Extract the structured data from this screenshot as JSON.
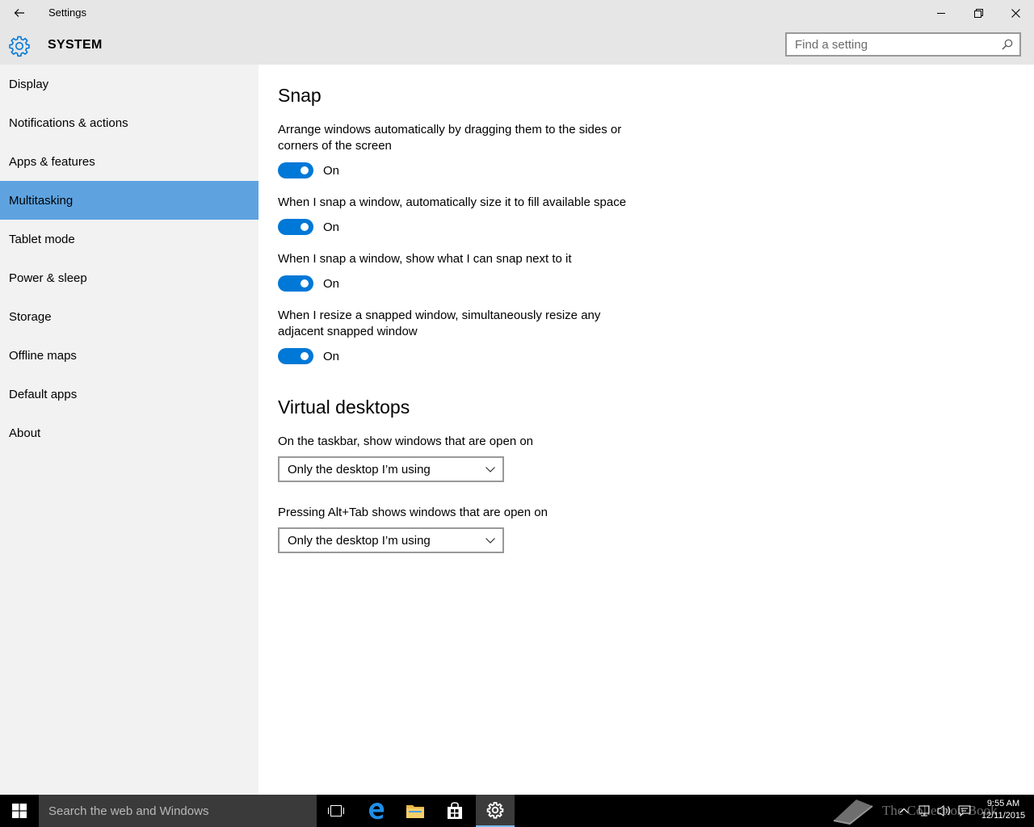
{
  "window": {
    "title": "Settings"
  },
  "header": {
    "section": "SYSTEM",
    "search_placeholder": "Find a setting"
  },
  "sidebar": {
    "items": [
      {
        "label": "Display"
      },
      {
        "label": "Notifications & actions"
      },
      {
        "label": "Apps & features"
      },
      {
        "label": "Multitasking"
      },
      {
        "label": "Tablet mode"
      },
      {
        "label": "Power & sleep"
      },
      {
        "label": "Storage"
      },
      {
        "label": "Offline maps"
      },
      {
        "label": "Default apps"
      },
      {
        "label": "About"
      }
    ],
    "selected": "Multitasking"
  },
  "snap": {
    "title": "Snap",
    "settings": [
      {
        "desc": "Arrange windows automatically by dragging them to the sides or corners of the screen",
        "state": "On"
      },
      {
        "desc": "When I snap a window, automatically size it to fill available space",
        "state": "On"
      },
      {
        "desc": "When I snap a window, show what I can snap next to it",
        "state": "On"
      },
      {
        "desc": "When I resize a snapped window, simultaneously resize any adjacent snapped window",
        "state": "On"
      }
    ]
  },
  "virtual_desktops": {
    "title": "Virtual desktops",
    "taskbar_label": "On the taskbar, show windows that are open on",
    "taskbar_value": "Only the desktop I’m using",
    "alttab_label": "Pressing Alt+Tab shows windows that are open on",
    "alttab_value": "Only the desktop I’m using"
  },
  "taskbar": {
    "search_placeholder": "Search the web and Windows",
    "time": "9:55 AM",
    "date": "12/11/2015",
    "watermark": "The Collection Book"
  },
  "colors": {
    "accent": "#0078d7",
    "selected_nav": "#5ea3e0",
    "chrome": "#e6e6e6",
    "sidebar": "#f2f2f2"
  },
  "icons": {
    "back": "back-arrow-icon",
    "minimize": "minimize-icon",
    "maximize": "restore-icon",
    "close": "close-icon",
    "system": "gear-icon",
    "search": "search-icon",
    "start": "windows-logo-icon",
    "task_view": "task-view-icon",
    "edge": "edge-browser-icon",
    "explorer": "file-explorer-icon",
    "store": "store-icon",
    "settings_app": "settings-gear-icon"
  }
}
